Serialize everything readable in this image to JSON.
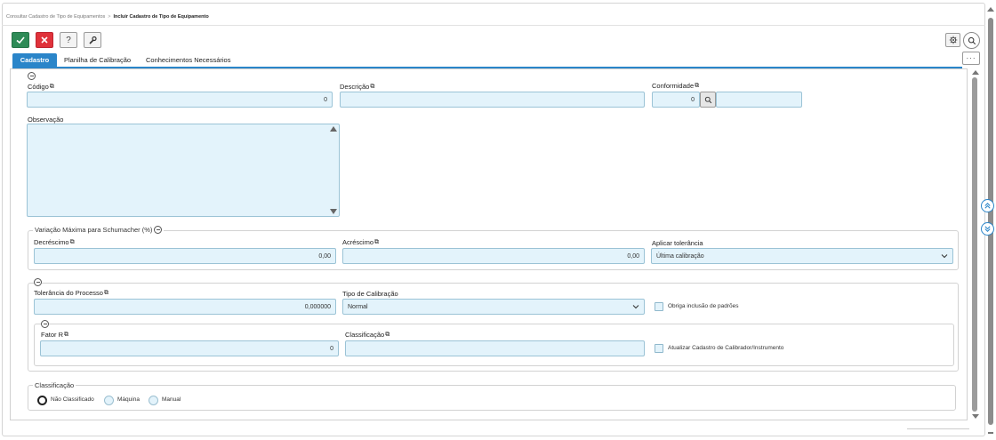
{
  "breadcrumb": {
    "parent": "Consultar Cadastro de Tipo de Equipamentos",
    "separator": ">",
    "current": "Incluir Cadastro de Tipo de Equipamento"
  },
  "toolbar": {
    "help_label": "?",
    "more_label": "···",
    "colors": {
      "confirm": "#2e8b57",
      "cancel": "#e0323a"
    },
    "icons": [
      "check-icon",
      "close-icon",
      "help-icon",
      "wrench-icon",
      "gear-icon",
      "search-icon"
    ]
  },
  "tabs": [
    {
      "label": "Cadastro",
      "active": true
    },
    {
      "label": "Planilha de Calibração",
      "active": false
    },
    {
      "label": "Conhecimentos Necessários",
      "active": false
    }
  ],
  "form": {
    "codigo": {
      "label": "Código",
      "value": "0"
    },
    "descricao": {
      "label": "Descrição",
      "value": ""
    },
    "conformidade": {
      "label": "Conformidade",
      "value": "0",
      "description": ""
    },
    "observacao": {
      "label": "Observação",
      "value": ""
    }
  },
  "schumacher": {
    "legend": "Variação Máxima para Schumacher (%)",
    "decrescimo": {
      "label": "Decréscimo",
      "value": "0,00"
    },
    "acrescimo": {
      "label": "Acréscimo",
      "value": "0,00"
    },
    "aplicar": {
      "label": "Aplicar tolerância",
      "value": "Última calibração"
    }
  },
  "processo": {
    "tolerancia": {
      "label": "Tolerância do Processo",
      "value": "0,000000"
    },
    "tipo": {
      "label": "Tipo de Calibração",
      "value": "Normal"
    },
    "obriga": {
      "label": "Obriga inclusão de padrões",
      "checked": false
    },
    "fator": {
      "label": "Fator R",
      "value": "0"
    },
    "classificacao": {
      "label": "Classificação",
      "value": ""
    },
    "atualizar": {
      "label": "Atualizar Cadastro de Calibrador/Instrumento",
      "checked": false
    }
  },
  "classificacao": {
    "legend": "Classificação",
    "options": [
      {
        "label": "Não Classificado",
        "selected": true
      },
      {
        "label": "Máquina",
        "selected": false
      },
      {
        "label": "Manual",
        "selected": false
      }
    ]
  },
  "theme": {
    "accent": "#2a85c9",
    "input_bg": "#e3f3fb"
  }
}
